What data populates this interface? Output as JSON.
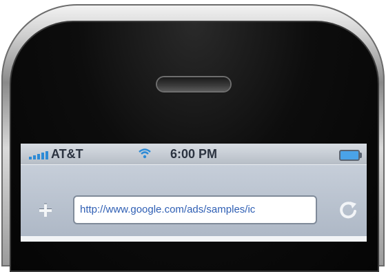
{
  "status_bar": {
    "carrier": "AT&T",
    "time": "6:00 PM",
    "signal_bars": 5,
    "wifi": true
  },
  "toolbar": {
    "add_label": "+",
    "url": "http://www.google.com/ads/samples/ic"
  },
  "colors": {
    "signal": "#2d8bd6",
    "battery": "#4aa3e8",
    "url_text": "#2f5fb4"
  },
  "icons": [
    "signal-icon",
    "wifi-icon",
    "battery-icon",
    "add-icon",
    "reload-icon"
  ]
}
